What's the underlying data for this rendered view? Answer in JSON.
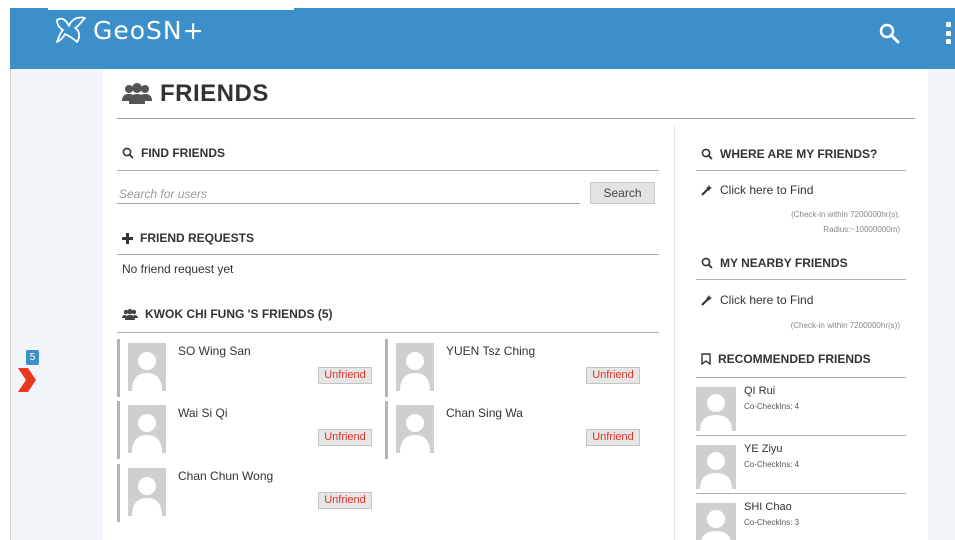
{
  "app": {
    "logo_text": "GeoSN+"
  },
  "sidebar": {
    "badge_count": "5"
  },
  "page": {
    "title": "FRIENDS"
  },
  "find_friends": {
    "heading": "FIND FRIENDS",
    "search_placeholder": "Search for users",
    "search_button": "Search"
  },
  "friend_requests": {
    "heading": "FRIEND REQUESTS",
    "empty_text": "No friend request yet"
  },
  "friends_list": {
    "heading": "KWOK CHI FUNG 'S FRIENDS (5)",
    "unfriend_label": "Unfriend",
    "friends": [
      {
        "name": "SO Wing San"
      },
      {
        "name": "YUEN Tsz Ching"
      },
      {
        "name": "Wai Si Qi"
      },
      {
        "name": "Chan Sing Wa"
      },
      {
        "name": "Chan Chun Wong"
      }
    ]
  },
  "where_friends": {
    "heading": "WHERE ARE MY FRIENDS?",
    "link": "Click here to Find",
    "note_line1": "(Check-in within 7200000hr(s),",
    "note_line2": "Radius:~10000000m)"
  },
  "nearby_friends": {
    "heading": "MY NEARBY FRIENDS",
    "link": "Click here to Find",
    "note": "(Check-in within 7200000hr(s))"
  },
  "recommended": {
    "heading": "RECOMMENDED FRIENDS",
    "items": [
      {
        "name": "QI Rui",
        "checkins": "Co-CheckIns: 4"
      },
      {
        "name": "YE Ziyu",
        "checkins": "Co-CheckIns: 4"
      },
      {
        "name": "SHI Chao",
        "checkins": "Co-CheckIns: 3"
      }
    ]
  },
  "colors": {
    "header_blue": "#3d8fca",
    "unfriend_red": "#d9342b",
    "sidebar_bg": "#f2f5f9"
  }
}
